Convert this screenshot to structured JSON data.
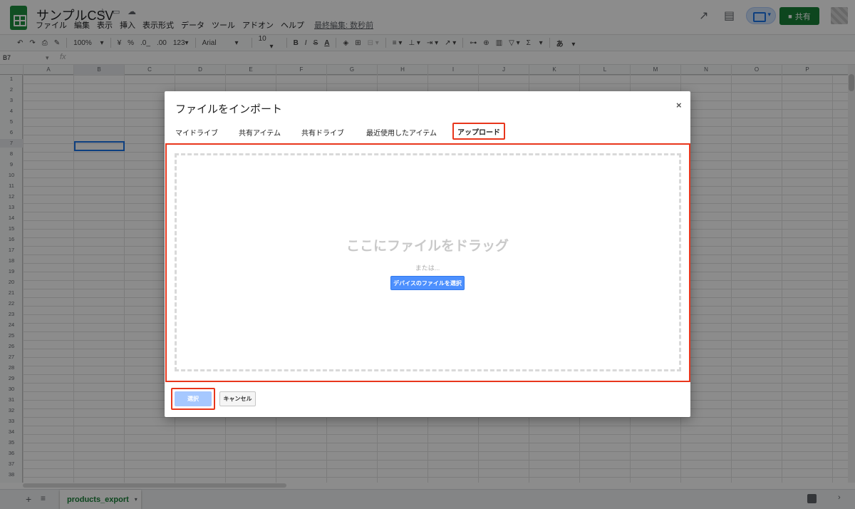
{
  "app": {
    "title": "サンプルCSV",
    "menu": [
      "ファイル",
      "編集",
      "表示",
      "挿入",
      "表示形式",
      "データ",
      "ツール",
      "アドオン",
      "ヘルプ"
    ],
    "last_edit": "最終編集: 数秒前",
    "share_label": "共有",
    "brand_color": "#188038"
  },
  "toolbar": {
    "zoom": "100%",
    "currency": "¥",
    "percent": "%",
    "decimal_less": ".0_",
    "decimal_more": ".00",
    "number_format": "123▾",
    "font": "Arial",
    "font_size": "10",
    "bold": "B",
    "italic": "I",
    "strike": "S",
    "text_color": "A",
    "sum": "Σ",
    "input_tool": "あ"
  },
  "formula_bar": {
    "cell_ref": "B7",
    "fx": "fx"
  },
  "grid": {
    "columns": [
      "A",
      "B",
      "C",
      "D",
      "E",
      "F",
      "G",
      "H",
      "I",
      "J",
      "K",
      "L",
      "M",
      "N",
      "O",
      "P"
    ],
    "rows": [
      "1",
      "2",
      "3",
      "4",
      "5",
      "6",
      "7",
      "8",
      "9",
      "10",
      "11",
      "12",
      "13",
      "14",
      "15",
      "16",
      "17",
      "18",
      "19",
      "20",
      "21",
      "22",
      "23",
      "24",
      "25",
      "26",
      "27",
      "28",
      "29",
      "30",
      "31",
      "32",
      "33",
      "34",
      "35",
      "36",
      "37",
      "38"
    ],
    "selected_cell": "B7"
  },
  "sheet_tabs": [
    {
      "label": "products_export",
      "active": true
    }
  ],
  "dialog": {
    "title": "ファイルをインポート",
    "close": "×",
    "tabs": [
      {
        "label": "マイドライブ",
        "active": false
      },
      {
        "label": "共有アイテム",
        "active": false
      },
      {
        "label": "共有ドライブ",
        "active": false
      },
      {
        "label": "最近使用したアイテム",
        "active": false
      },
      {
        "label": "アップロード",
        "active": true
      }
    ],
    "drag_text": "ここにファイルをドラッグ",
    "or_text": "または...",
    "device_button": "デバイスのファイルを選択",
    "select_button": "選択",
    "cancel_button": "キャンセル",
    "highlight_color": "#e8361c",
    "primary_color": "#4d90fe"
  }
}
